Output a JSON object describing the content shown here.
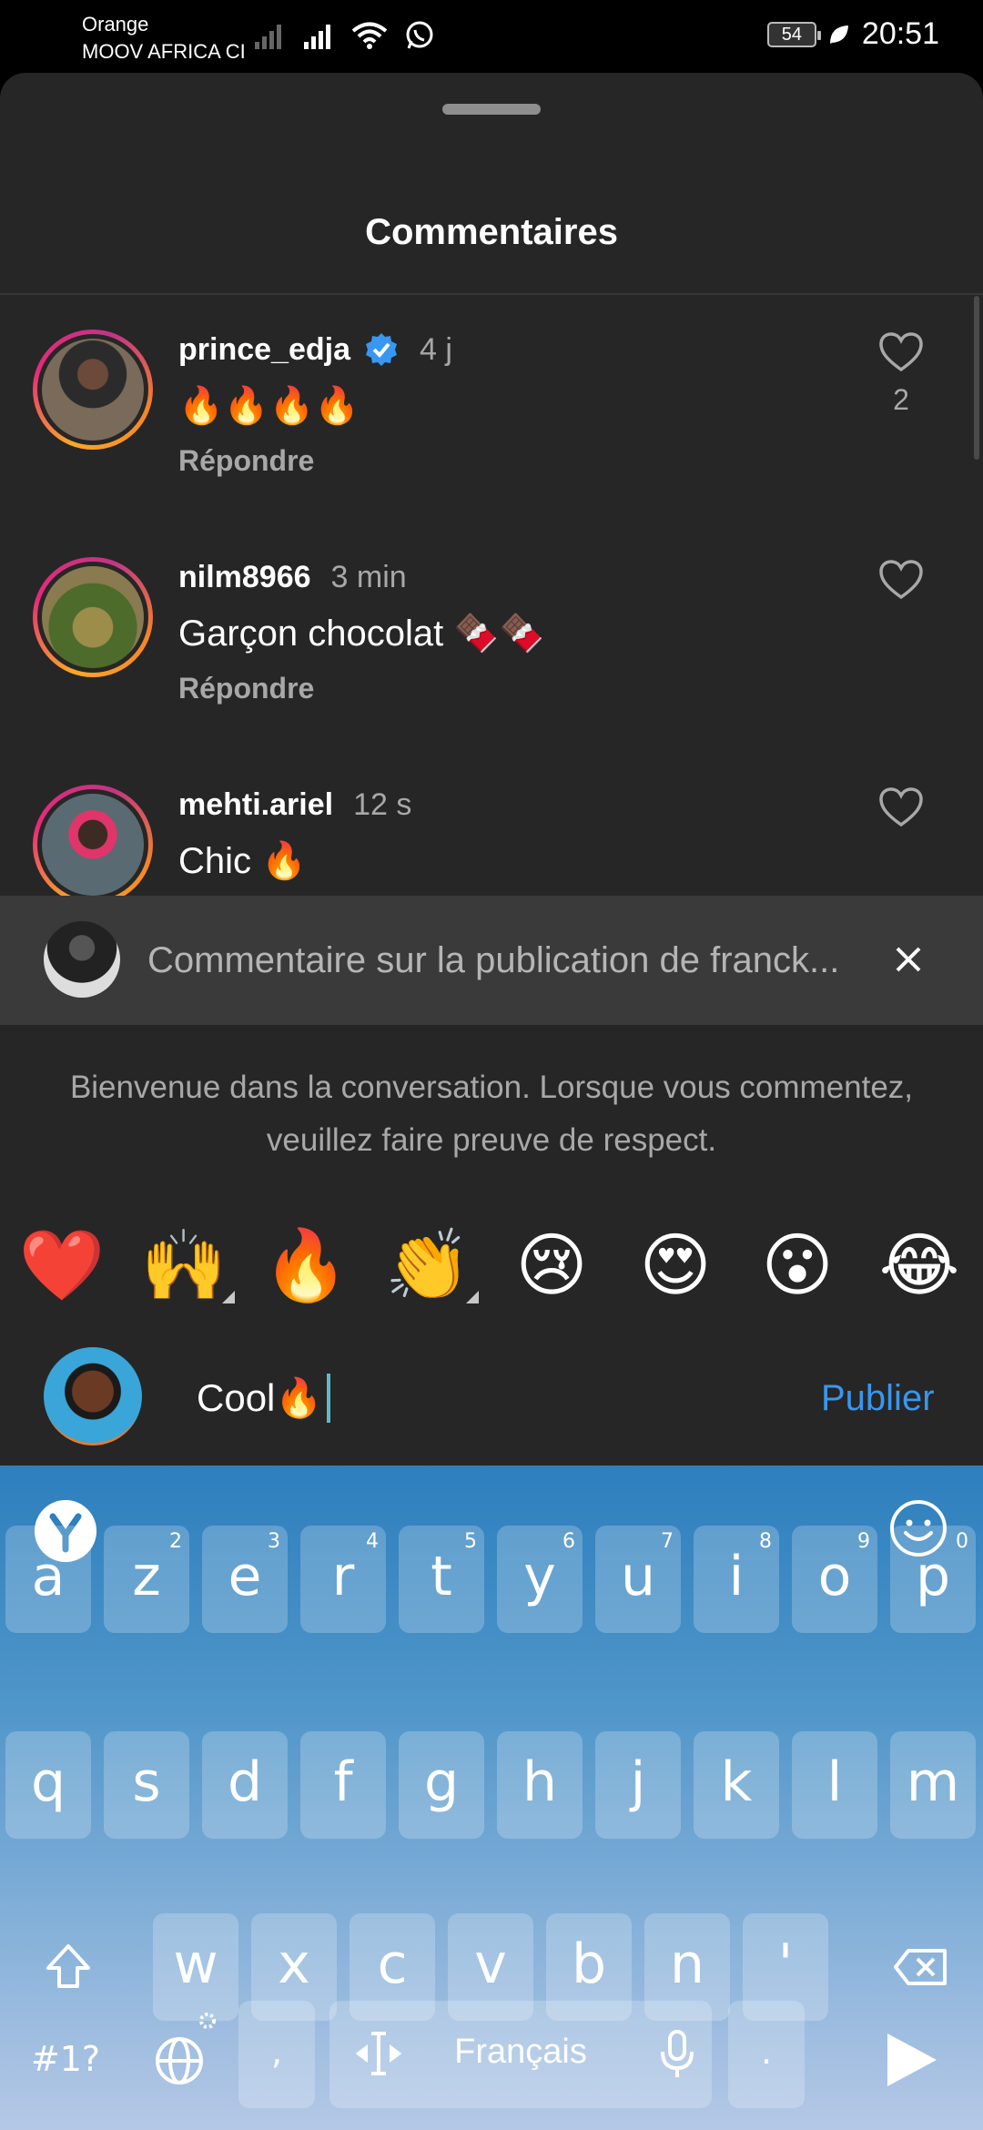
{
  "status_bar": {
    "carrier_line1": "Orange",
    "carrier_line2": "MOOV AFRICA CI",
    "battery": "54",
    "time": "20:51"
  },
  "sheet": {
    "title": "Commentaires"
  },
  "comments": [
    {
      "username": "prince_edja",
      "verified": true,
      "time": "4 j",
      "text": "🔥🔥🔥🔥",
      "reply_label": "Répondre",
      "likes": "2"
    },
    {
      "username": "nilm8966",
      "verified": false,
      "time": "3 min",
      "text": "Garçon chocolat 🍫🍫",
      "reply_label": "Répondre",
      "likes": ""
    },
    {
      "username": "mehti.ariel",
      "verified": false,
      "time": "12 s",
      "text": "Chic 🔥",
      "reply_label": "",
      "likes": ""
    }
  ],
  "reply_bar": {
    "text": "Commentaire sur la publication de franck..."
  },
  "welcome": {
    "line1": "Bienvenue dans la conversation. Lorsque vous commentez,",
    "line2": "veuillez faire preuve de respect."
  },
  "emoji_bar": [
    "❤️",
    "🙌",
    "🔥",
    "👏",
    "😢",
    "😍",
    "😮",
    "😂"
  ],
  "composer": {
    "value": "Cool🔥",
    "publish_label": "Publier"
  },
  "keyboard": {
    "row1": [
      {
        "k": "a",
        "n": "1"
      },
      {
        "k": "z",
        "n": "2"
      },
      {
        "k": "e",
        "n": "3"
      },
      {
        "k": "r",
        "n": "4"
      },
      {
        "k": "t",
        "n": "5"
      },
      {
        "k": "y",
        "n": "6"
      },
      {
        "k": "u",
        "n": "7"
      },
      {
        "k": "i",
        "n": "8"
      },
      {
        "k": "o",
        "n": "9"
      },
      {
        "k": "p",
        "n": "0"
      }
    ],
    "row2": [
      "q",
      "s",
      "d",
      "f",
      "g",
      "h",
      "j",
      "k",
      "l",
      "m"
    ],
    "row3": [
      "w",
      "x",
      "c",
      "v",
      "b",
      "n",
      "'"
    ],
    "symbols_label": "#1?",
    "comma": ",",
    "space_label": "Français",
    "period": "."
  }
}
